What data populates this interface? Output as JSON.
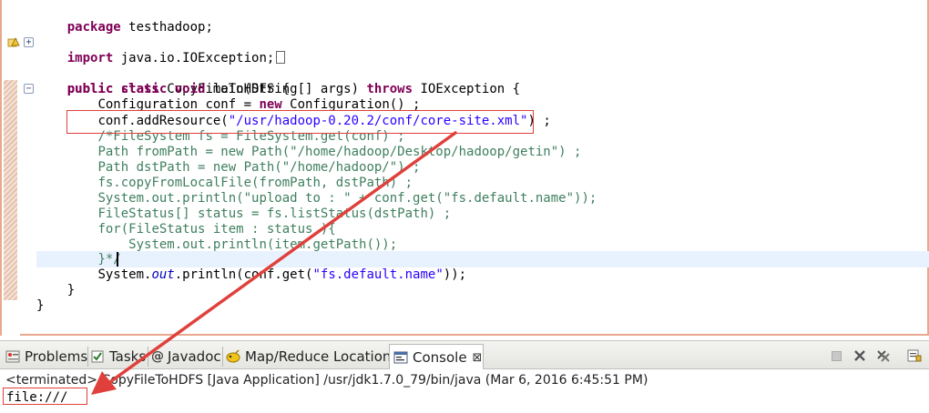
{
  "editor": {
    "lines": {
      "l1": {
        "kw": "package",
        "rest": " testhadoop;"
      },
      "l3": {
        "kw": "import",
        "rest": " java.io.IOException;"
      },
      "l5": {
        "kw": "public class",
        "rest": " CopyFileToHDFS {"
      },
      "l6": {
        "kw1": "public static void",
        "mid": " main(String[] args) ",
        "kw2": "throws",
        "rest": " IOException {"
      },
      "l7": {
        "pre": "Configuration conf = ",
        "kw": "new",
        "rest": " Configuration() ;"
      },
      "l8": {
        "pre": "conf.addResource(",
        "str": "\"/usr/hadoop-0.20.2/conf/core-site.xml\"",
        "rest": ") ;"
      },
      "c1": "/*FileSystem fs = FileSystem.get(conf) ;",
      "c2": "Path fromPath = new Path(\"/home/hadoop/Desktop/hadoop/getin\") ;",
      "c3": "Path dstPath = new Path(\"/home/hadoop/\") ;",
      "c4": "fs.copyFromLocalFile(fromPath, dstPath) ;",
      "c5": "System.out.println(\"upload to : \" + conf.get(\"fs.default.name\"));",
      "c6": "FileStatus[] status = fs.listStatus(dstPath) ;",
      "c7": "for(FileStatus item : status ){",
      "c8": "System.out.println(item.getPath());",
      "c9": "}*/",
      "l18": {
        "pre": "System.",
        "fld": "out",
        "mid": ".println(conf.get(",
        "str": "\"fs.default.name\"",
        "rest": "));"
      },
      "l19": "}",
      "l20": "}"
    }
  },
  "panel": {
    "tabs": {
      "problems": "Problems",
      "tasks": "Tasks",
      "javadoc": "Javadoc",
      "mapreduce": "Map/Reduce Locations",
      "console": "Console"
    },
    "console_close": "⊠"
  },
  "console": {
    "status": "<terminated> CopyFileToHDFS [Java Application] /usr/jdk1.7.0_79/bin/java (Mar 6, 2016 6:45:51 PM)",
    "output": "file:///"
  },
  "colors": {
    "keyword": "#7f0055",
    "string": "#2a00ff",
    "comment": "#3f7f5f",
    "annotation": "#e0403b"
  },
  "icons": [
    "fold-collapse-icon",
    "warning-marker-icon",
    "problems-icon",
    "tasks-icon",
    "javadoc-icon",
    "mapreduce-icon",
    "console-icon",
    "terminate-icon",
    "remove-launch-icon",
    "remove-all-icon",
    "scroll-lock-icon"
  ]
}
